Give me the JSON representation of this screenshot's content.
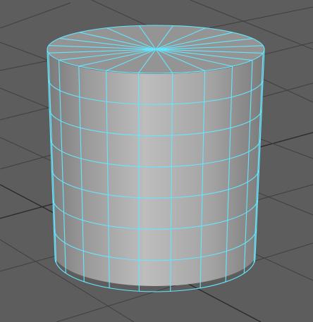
{
  "viewport": {
    "background_color": "#5d5d5d",
    "grid_color": "#3f3f3f",
    "grid_axis_color": "#2a2a2a"
  },
  "object": {
    "type": "polyCylinder",
    "state": "selected",
    "subdivisions_axis": 20,
    "subdivisions_height": 7,
    "shading": "smooth gray",
    "wireframe_color": "#64e6ff",
    "body_color_light": "#bdbdbd",
    "body_color_mid": "#a4a4a4",
    "body_color_dark": "#7a7a7a",
    "cap_color": "#949494"
  }
}
